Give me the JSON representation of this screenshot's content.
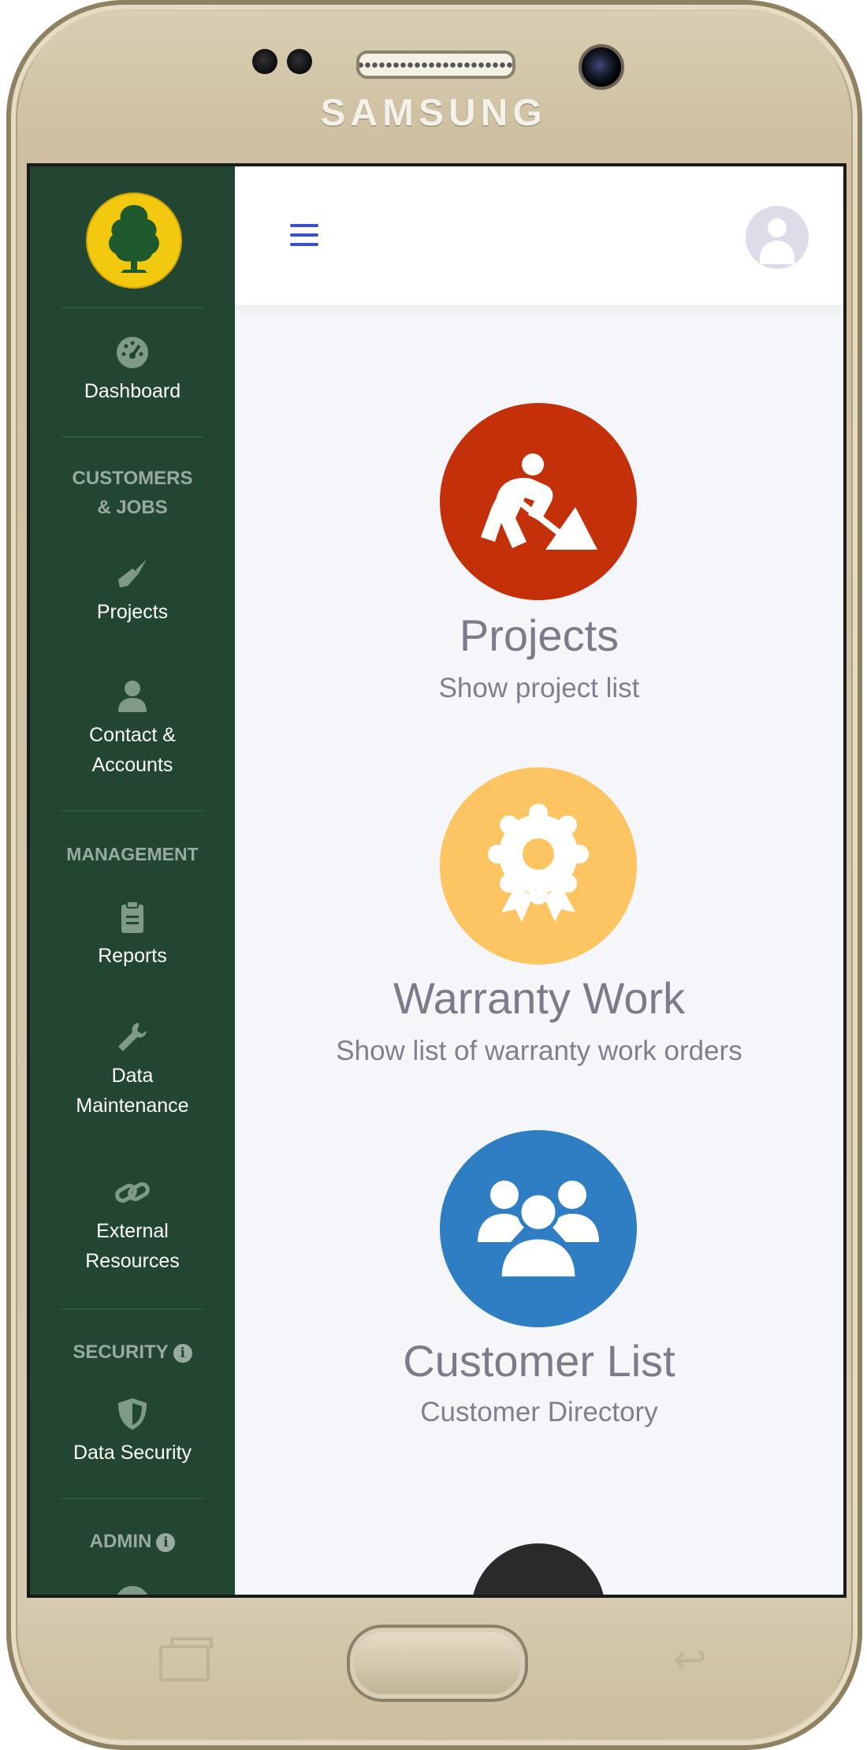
{
  "device": {
    "brand": "SAMSUNG"
  },
  "colors": {
    "sidebar": "#224631",
    "projects": "#c4300a",
    "warranty": "#fdc561",
    "customers": "#2f7ec4",
    "accent": "#3b4fcc"
  },
  "sidebar": {
    "logo_icon": "tree-logo-icon",
    "dashboard": {
      "label": "Dashboard",
      "icon": "gauge-icon"
    },
    "section_customers": "CUSTOMERS & JOBS",
    "projects": {
      "label": "Projects",
      "icon": "trowel-icon"
    },
    "contacts": {
      "label": "Contact & Accounts",
      "icon": "user-icon"
    },
    "section_management": "MANAGEMENT",
    "reports": {
      "label": "Reports",
      "icon": "clipboard-icon"
    },
    "maintenance": {
      "label": "Data Maintenance",
      "icon": "wrench-icon"
    },
    "external": {
      "label": "External Resources",
      "icon": "link-icon"
    },
    "section_security": "SECURITY",
    "data_security": {
      "label": "Data Security",
      "icon": "shield-icon"
    },
    "section_admin": "ADMIN"
  },
  "topbar": {
    "menu_icon": "hamburger-icon",
    "avatar_icon": "user-avatar-icon"
  },
  "cards": [
    {
      "title": "Projects",
      "subtitle": "Show project list",
      "icon": "construction-worker-icon"
    },
    {
      "title": "Warranty Work",
      "subtitle": "Show list of warranty work orders",
      "icon": "award-ribbon-icon"
    },
    {
      "title": "Customer List",
      "subtitle": "Customer Directory",
      "icon": "users-group-icon"
    }
  ]
}
